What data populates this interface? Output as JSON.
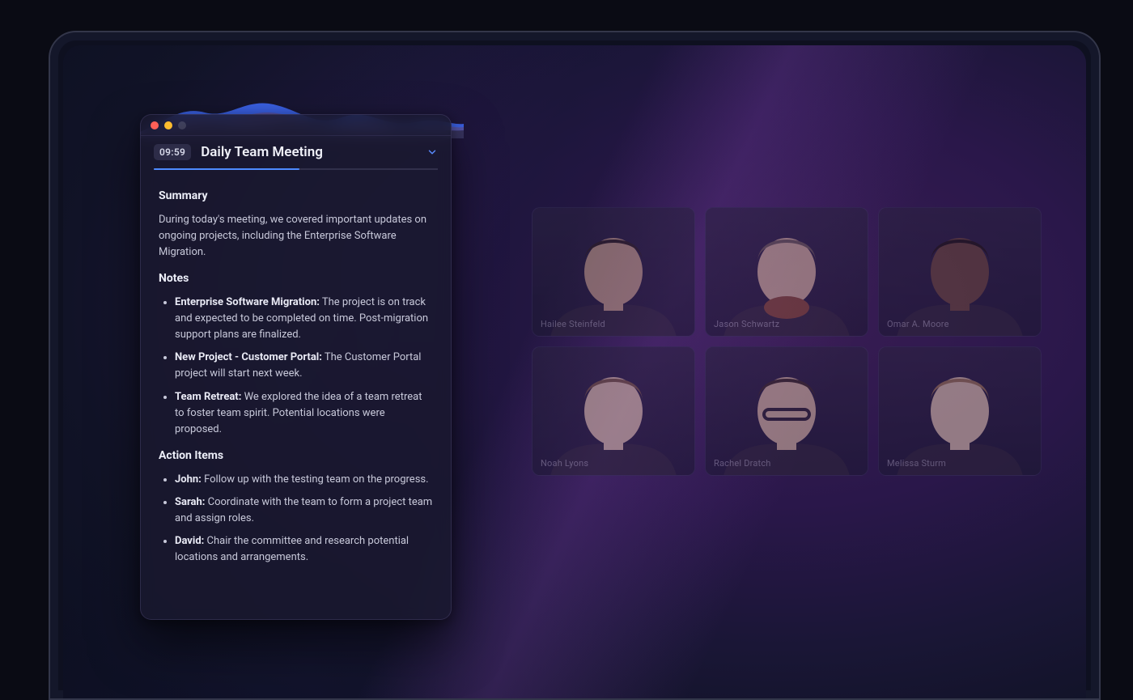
{
  "meeting": {
    "timer": "09:59",
    "title": "Daily Team Meeting"
  },
  "summary": {
    "heading": "Summary",
    "text": "During today's meeting, we covered important updates on ongoing projects, including the Enterprise Software Migration."
  },
  "notes": {
    "heading": "Notes",
    "items": [
      {
        "label": "Enterprise Software Migration:",
        "text": " The project is on track and expected to be completed on time. Post-migration support plans are finalized."
      },
      {
        "label": "New Project - Customer Portal:",
        "text": " The Customer Portal project will start next week."
      },
      {
        "label": "Team Retreat:",
        "text": " We explored the idea of a team retreat to foster team spirit. Potential locations were proposed."
      }
    ]
  },
  "action_items": {
    "heading": "Action Items",
    "items": [
      {
        "label": "John:",
        "text": " Follow up with the testing team on the progress."
      },
      {
        "label": "Sarah:",
        "text": " Coordinate with the team to form a project team and assign roles."
      },
      {
        "label": "David:",
        "text": " Chair the committee and research potential locations and arrangements."
      }
    ]
  },
  "participants": [
    {
      "name": "Hailee Steinfeld"
    },
    {
      "name": "Jason Schwartz"
    },
    {
      "name": "Omar A. Moore"
    },
    {
      "name": "Noah Lyons"
    },
    {
      "name": "Rachel Dratch"
    },
    {
      "name": "Melissa Sturm"
    }
  ]
}
